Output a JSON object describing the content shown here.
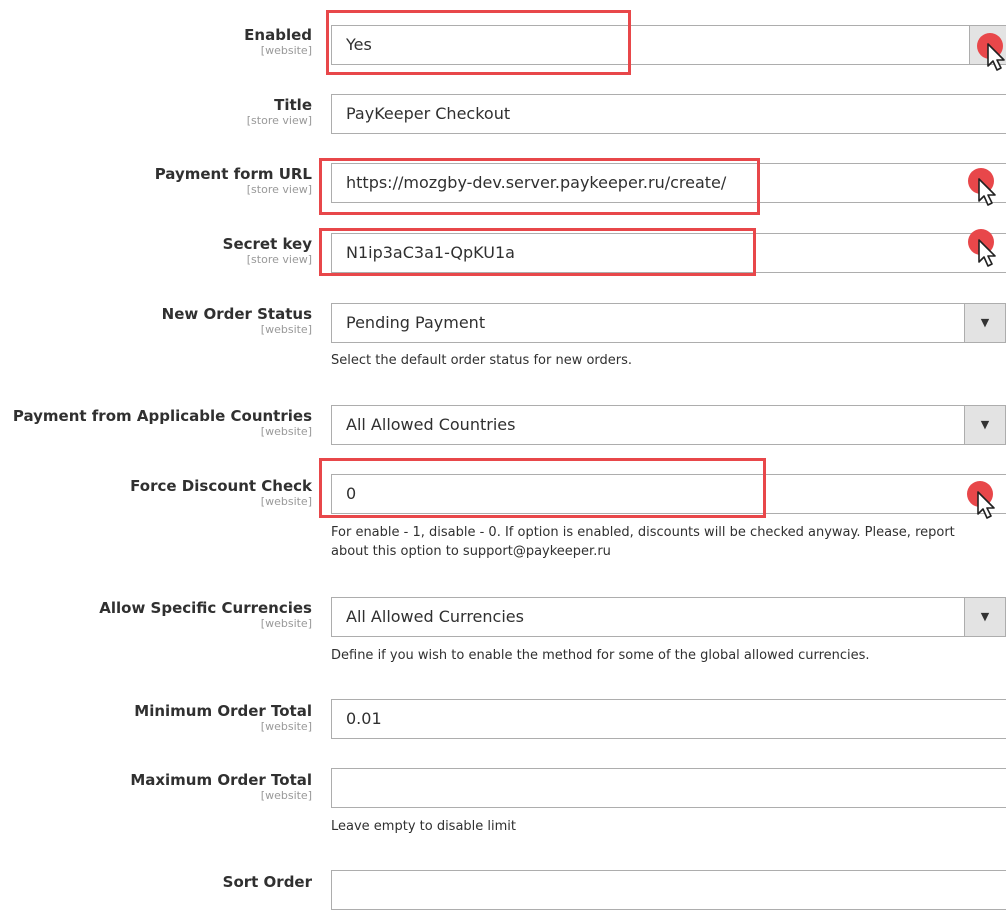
{
  "fields": {
    "enabled": {
      "label": "Enabled",
      "scope": "[website]",
      "value": "Yes"
    },
    "title": {
      "label": "Title",
      "scope": "[store view]",
      "value": "PayKeeper Checkout"
    },
    "payment_form_url": {
      "label": "Payment form URL",
      "scope": "[store view]",
      "value": "https://mozgby-dev.server.paykeeper.ru/create/"
    },
    "secret_key": {
      "label": "Secret key",
      "scope": "[store view]",
      "value": "N1ip3aC3a1-QpKU1a"
    },
    "new_order_status": {
      "label": "New Order Status",
      "scope": "[website]",
      "value": "Pending Payment",
      "note": "Select the default order status for new orders."
    },
    "applicable_countries": {
      "label": "Payment from Applicable Countries",
      "scope": "[website]",
      "value": "All Allowed Countries"
    },
    "force_discount_check": {
      "label": "Force Discount Check",
      "scope": "[website]",
      "value": "0",
      "note_line1": "For enable - 1, disable - 0. If option is enabled, discounts will be checked anyway. Please, report",
      "note_line2": "about this option to support@paykeeper.ru"
    },
    "allow_specific_currencies": {
      "label": "Allow Specific Currencies",
      "scope": "[website]",
      "value": "All Allowed Currencies",
      "note": "Define if you wish to enable the method for some of the global allowed currencies."
    },
    "minimum_order_total": {
      "label": "Minimum Order Total",
      "scope": "[website]",
      "value": "0.01"
    },
    "maximum_order_total": {
      "label": "Maximum Order Total",
      "scope": "[website]",
      "value": "",
      "note": "Leave empty to disable limit"
    },
    "sort_order": {
      "label": "Sort Order",
      "value": ""
    }
  },
  "icons": {
    "select_arrow": "chevron-down-icon",
    "cursor": "mouse-pointer-icon"
  },
  "colors": {
    "highlight": "#e8474a",
    "cursor_dot": "#e8474a"
  }
}
